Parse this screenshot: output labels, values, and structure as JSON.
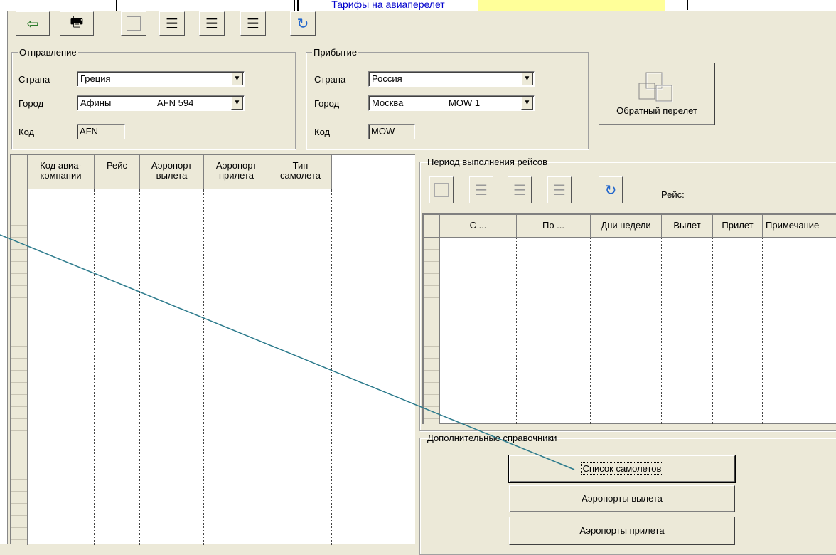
{
  "window": {
    "tabs": {
      "top_tab_label": "Тарифы на авиаперелет"
    }
  },
  "toolbar": {
    "buttons": [
      {
        "name": "exit-button",
        "icon": "exit-icon"
      },
      {
        "name": "print-button",
        "icon": "printer-icon"
      },
      {
        "name": "blank-button",
        "icon": "blank-icon"
      },
      {
        "name": "insert-record-button",
        "icon": "insert-rows-icon"
      },
      {
        "name": "copy-record-button",
        "icon": "copy-rows-icon"
      },
      {
        "name": "delete-record-button",
        "icon": "delete-rows-icon"
      },
      {
        "name": "refresh-button",
        "icon": "refresh-icon"
      }
    ]
  },
  "departure": {
    "legend": "Отправление",
    "country_label": "Страна",
    "country_value": "Греция",
    "city_label": "Город",
    "city_value": "Афины",
    "city_code_value": "AFN 594",
    "code_label": "Код",
    "code_value": "AFN"
  },
  "arrival": {
    "legend": "Прибытие",
    "country_label": "Страна",
    "country_value": "Россия",
    "city_label": "Город",
    "city_value": "Москва",
    "city_code_value": "MOW 1",
    "code_label": "Код",
    "code_value": "MOW"
  },
  "return_flight_button": "Обратный перелет",
  "flights_grid": {
    "columns": [
      "Код авиа-компании",
      "Рейс",
      "Аэропорт вылета",
      "Аэропорт прилета",
      "Тип самолета"
    ],
    "col1a": "Код авиа-",
    "col1b": "компании",
    "col2": "Рейс",
    "col3a": "Аэропорт",
    "col3b": "вылета",
    "col4a": "Аэропорт",
    "col4b": "прилета",
    "col5a": "Тип",
    "col5b": "самолета"
  },
  "period": {
    "legend": "Период выполнения рейсов",
    "flight_label": "Рейс:",
    "columns": [
      "С ...",
      "По ...",
      "Дни недели",
      "Вылет",
      "Прилет",
      "Примечание"
    ]
  },
  "references": {
    "legend": "Дополнительные справочники",
    "aircraft_list": "Список самолетов",
    "departure_airports": "Аэропорты вылета",
    "arrival_airports": "Аэропорты прилета"
  },
  "colors": {
    "background": "#ece9d8",
    "annotation_line": "#2b7a8c",
    "tab_text": "#0000cc",
    "highlight_tab": "#ffff99"
  }
}
